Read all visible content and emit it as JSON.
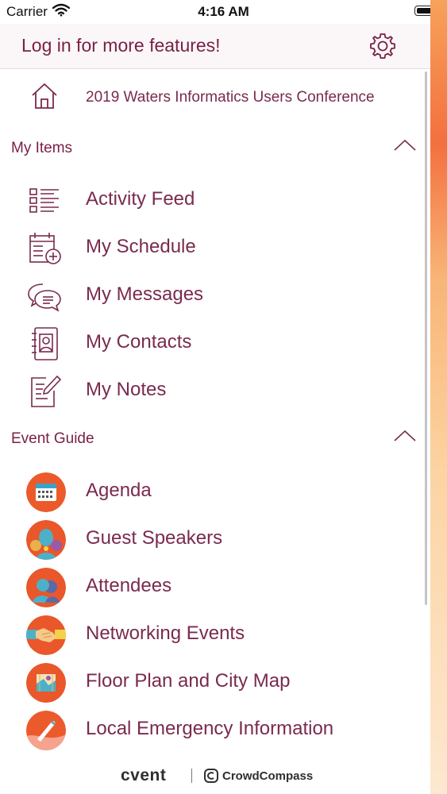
{
  "status_bar": {
    "carrier": "Carrier",
    "time": "4:16 AM"
  },
  "header": {
    "title": "Log in for more features!",
    "settings_icon": "gear-icon"
  },
  "home": {
    "label": "2019 Waters Informatics Users Conference",
    "icon": "home-icon"
  },
  "my_items": {
    "title": "My Items",
    "items": [
      {
        "label": "Activity Feed",
        "icon": "activity-feed-icon"
      },
      {
        "label": "My Schedule",
        "icon": "calendar-add-icon"
      },
      {
        "label": "My Messages",
        "icon": "messages-icon"
      },
      {
        "label": "My Contacts",
        "icon": "contacts-icon"
      },
      {
        "label": "My Notes",
        "icon": "notes-icon"
      }
    ]
  },
  "event_guide": {
    "title": "Event Guide",
    "items": [
      {
        "label": "Agenda",
        "icon": "agenda-icon"
      },
      {
        "label": "Guest Speakers",
        "icon": "speakers-icon"
      },
      {
        "label": "Attendees",
        "icon": "attendees-icon"
      },
      {
        "label": "Networking Events",
        "icon": "handshake-icon"
      },
      {
        "label": "Floor Plan and City Map",
        "icon": "map-icon"
      },
      {
        "label": "Local Emergency Information",
        "icon": "emergency-icon"
      }
    ]
  },
  "footer": {
    "brand": "cvent",
    "partner": "CrowdCompass"
  },
  "colors": {
    "accent": "#7a2a4f",
    "orange": "#f15a2b",
    "header_bg": "#fbf7f8"
  }
}
